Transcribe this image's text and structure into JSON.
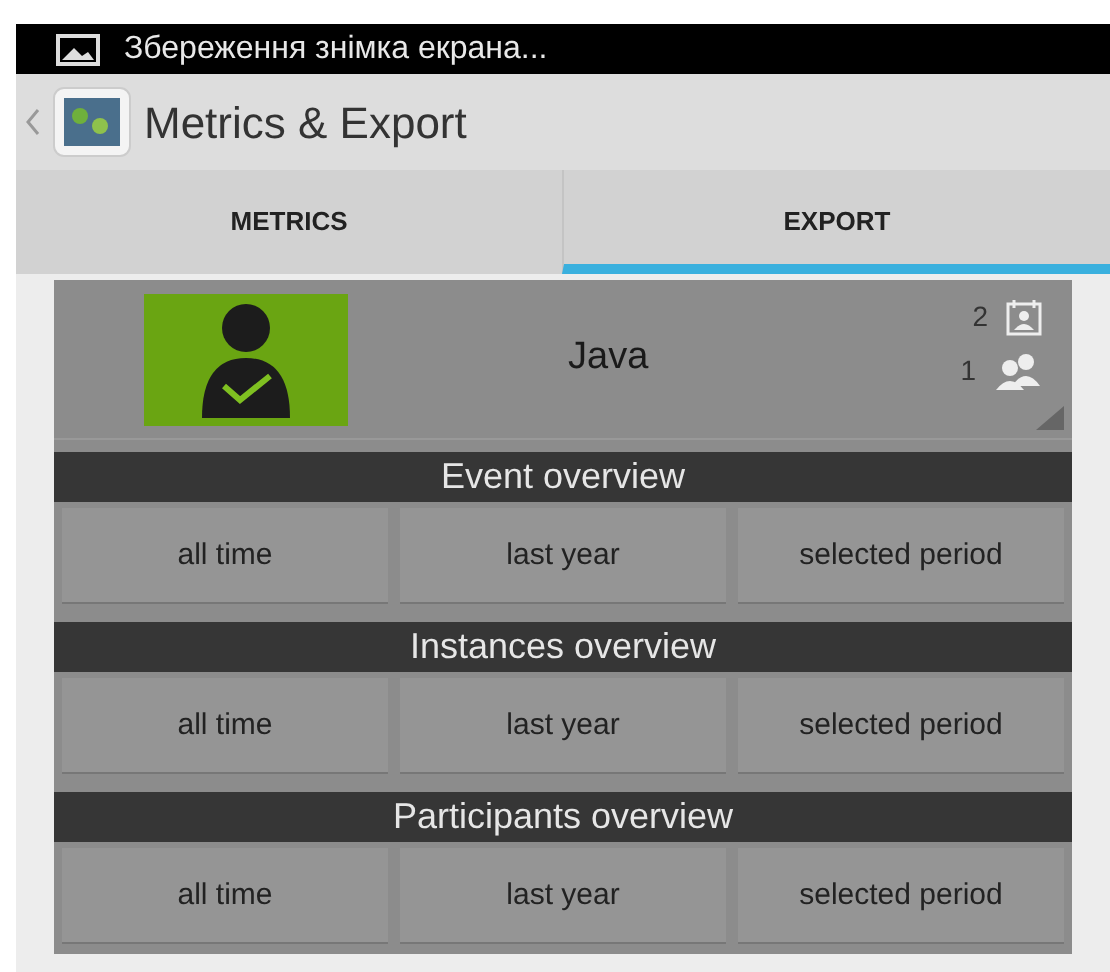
{
  "status_bar": {
    "notification": "Збереження знімка екрана..."
  },
  "action_bar": {
    "title": "Metrics & Export"
  },
  "tabs": [
    {
      "label": "METRICS",
      "selected": false
    },
    {
      "label": "EXPORT",
      "selected": true
    }
  ],
  "profile": {
    "name": "Java",
    "events_count": "2",
    "participants_count": "1"
  },
  "sections": [
    {
      "title": "Event overview",
      "buttons": [
        "all time",
        "last year",
        "selected period"
      ]
    },
    {
      "title": "Instances overview",
      "buttons": [
        "all time",
        "last year",
        "selected period"
      ]
    },
    {
      "title": "Participants overview",
      "buttons": [
        "all time",
        "last year",
        "selected period"
      ]
    }
  ]
}
